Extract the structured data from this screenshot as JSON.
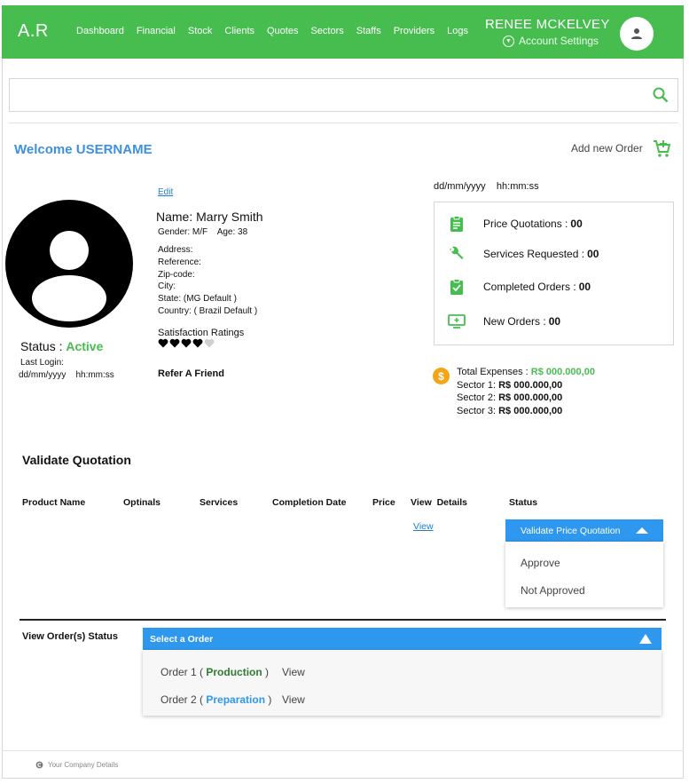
{
  "header": {
    "logo": "A.R",
    "nav": [
      "Dashboard",
      "Financial",
      "Stock",
      "Clients",
      "Quotes",
      "Sectors",
      "Staffs",
      "Providers",
      "Logs"
    ],
    "user_name": "RENEE MCKELVEY",
    "account_settings": "Account Settings",
    "bar_color": "#47bd50"
  },
  "search": {
    "placeholder": ""
  },
  "welcome": "Welcome USERNAME",
  "add_new_order": "Add new Order",
  "profile": {
    "edit": "Edit",
    "name": "Name: Marry Smith",
    "gender_age": "Gender: M/F    Age: 38",
    "address": "Address:",
    "reference": "Reference:",
    "zip": "Zip-code:",
    "city": "City:",
    "state": "State: (MG Default )",
    "country": "Country: ( Brazil Default )",
    "satisfaction_label": "Satisfaction Ratings",
    "rating": 4,
    "rating_max": 5,
    "refer": "Refer A Friend",
    "status_label": "Status :",
    "status_value": "Active",
    "last_login_label": "Last Login:",
    "last_login_value": "dd/mm/yyyy    hh:mm:ss"
  },
  "datetime": "dd/mm/yyyy    hh:mm:ss",
  "stats": [
    {
      "label": "Price Quotations :",
      "value": "00",
      "icon": "clipboard-icon"
    },
    {
      "label": "Services Requested :",
      "value": "00",
      "icon": "wrench-icon"
    },
    {
      "label": "Completed Orders :",
      "value": "00",
      "icon": "clipboard-check-icon"
    },
    {
      "label": "New Orders :",
      "value": "00",
      "icon": "monitor-add-icon"
    }
  ],
  "expenses": {
    "total_label": "Total Expenses :",
    "total_value": "R$ 000.000,00",
    "s1_label": "Sector 1:",
    "s1_value": "R$ 000.000,00",
    "s2_label": "Sector 2:",
    "s2_value": "R$ 000.000,00",
    "s3_label": "Sector 3:",
    "s3_value": "R$ 000.000,00"
  },
  "validate": {
    "title": "Validate Quotation",
    "columns": [
      "Product Name",
      "Optinals",
      "Services",
      "Completion Date",
      "Price",
      "View  Details",
      "Status"
    ],
    "view_link": "View",
    "button": "Validate Price Quotation",
    "options": [
      "Approve",
      "Not Approved"
    ]
  },
  "orders": {
    "title": "View Order(s) Status",
    "select": "Select a Order",
    "items": [
      {
        "prefix": "Order 1 (",
        "status": "Production",
        "suffix": ")",
        "view": "View"
      },
      {
        "prefix": "Order 2 (",
        "status": "Preparation",
        "suffix": ")",
        "view": "View"
      }
    ]
  },
  "footer": "Your Company Details"
}
